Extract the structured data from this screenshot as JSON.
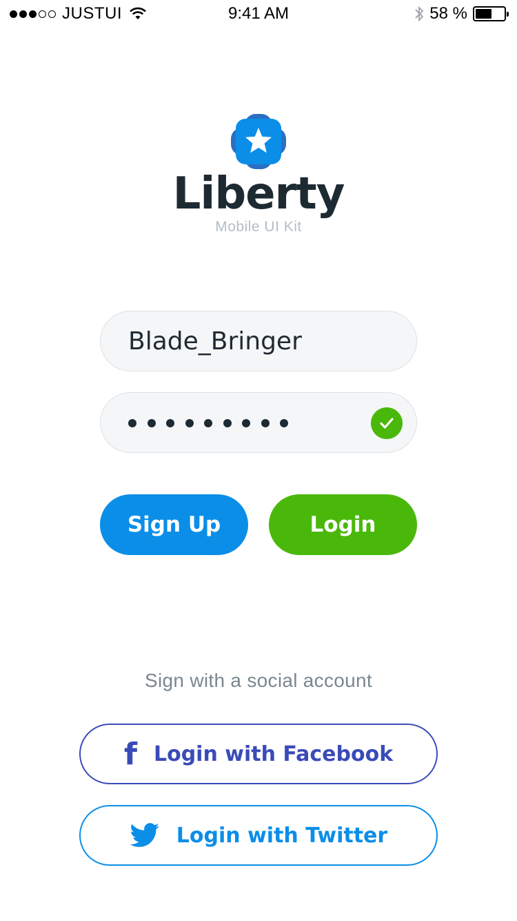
{
  "status_bar": {
    "carrier": "JUSTUI",
    "time": "9:41 AM",
    "battery_text": "58 %",
    "battery_level": 0.58,
    "signal_bars_filled": 3,
    "signal_bars_total": 5
  },
  "brand": {
    "name": "Liberty",
    "tagline": "Mobile UI Kit",
    "logo_icon": "star-badge-icon",
    "logo_color": "#0a8ee8"
  },
  "form": {
    "username_value": "Blade_Bringer",
    "password_length": 9,
    "password_valid_icon": "check-icon"
  },
  "buttons": {
    "signup_label": "Sign Up",
    "login_label": "Login"
  },
  "social": {
    "heading": "Sign with a social account",
    "facebook_label": "Login with Facebook",
    "twitter_label": "Login with Twitter"
  },
  "colors": {
    "primary_blue": "#0a8ee8",
    "success_green": "#4ab80b",
    "facebook_blue": "#3a4bb8",
    "text_dark": "#1e2a32"
  }
}
